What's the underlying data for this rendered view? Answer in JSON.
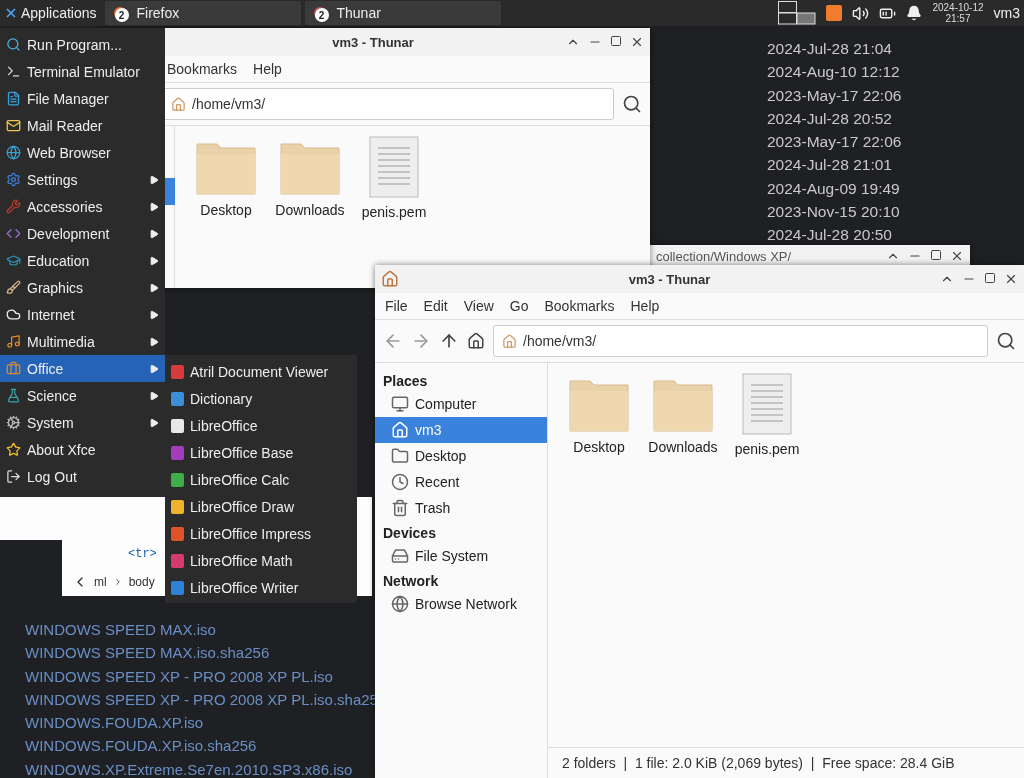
{
  "panel": {
    "apps_button": "Applications",
    "tasks": [
      {
        "label": "Firefox",
        "count": "2",
        "selected": false
      },
      {
        "label": "Thunar",
        "count": "2",
        "selected": false
      }
    ],
    "clock_date": "2024-10-12",
    "clock_time": "21:57",
    "user": "vm3"
  },
  "terminal": {
    "dates": [
      "2024-Jul-28 21:04",
      "2024-Aug-10 12:12",
      "2023-May-17 22:06",
      "2024-Jul-28 20:52",
      "2023-May-17 22:06",
      "2024-Jul-28 21:01",
      "2024-Aug-09 19:49",
      "2023-Nov-15 20:10",
      "2024-Jul-28 20:50"
    ],
    "files": [
      "WINDOWS SPEED MAX.iso",
      "WINDOWS SPEED MAX.iso.sha256",
      "WINDOWS SPEED XP - PRO 2008 XP PL.iso",
      "WINDOWS SPEED XP - PRO 2008 XP PL.iso.sha25",
      "WINDOWS.FOUDA.XP.iso",
      "WINDOWS.FOUDA.XP.iso.sha256",
      "WINDOWS.XP.Extreme.Se7en.2010.SP3.x86.iso"
    ]
  },
  "xp_window": {
    "title": "collection/Windows XP/"
  },
  "devtools": {
    "tag": "<tr>",
    "breadcrumbs": [
      "ml",
      "body"
    ]
  },
  "back_thunar": {
    "title": "vm3 - Thunar",
    "menu": [
      "Bookmarks",
      "Help"
    ],
    "address": "/home/vm3/",
    "files": [
      {
        "name": "Desktop",
        "kind": "folder"
      },
      {
        "name": "Downloads",
        "kind": "folder"
      },
      {
        "name": "penis.pem",
        "kind": "file"
      }
    ]
  },
  "front_thunar": {
    "title": "vm3 - Thunar",
    "menu": [
      "File",
      "Edit",
      "View",
      "Go",
      "Bookmarks",
      "Help"
    ],
    "address": "/home/vm3/",
    "sidebar": [
      {
        "heading": "Places",
        "items": [
          {
            "label": "Computer",
            "selected": false
          },
          {
            "label": "vm3",
            "selected": true
          },
          {
            "label": "Desktop",
            "selected": false
          },
          {
            "label": "Recent",
            "selected": false
          },
          {
            "label": "Trash",
            "selected": false
          }
        ]
      },
      {
        "heading": "Devices",
        "items": [
          {
            "label": "File System",
            "selected": false
          }
        ]
      },
      {
        "heading": "Network",
        "items": [
          {
            "label": "Browse Network",
            "selected": false
          }
        ]
      }
    ],
    "files": [
      {
        "name": "Desktop",
        "kind": "folder"
      },
      {
        "name": "Downloads",
        "kind": "folder"
      },
      {
        "name": "penis.pem",
        "kind": "file"
      }
    ],
    "status_bar": "2 folders  |  1 file: 2.0 KiB (2,069 bytes)  |  Free space: 28.4 GiB"
  },
  "app_menu": {
    "items": [
      {
        "label": "Run Program...",
        "submenu": false,
        "selected": false
      },
      {
        "label": "Terminal Emulator",
        "submenu": false,
        "selected": false
      },
      {
        "label": "File Manager",
        "submenu": false,
        "selected": false
      },
      {
        "label": "Mail Reader",
        "submenu": false,
        "selected": false
      },
      {
        "label": "Web Browser",
        "submenu": false,
        "selected": false
      },
      {
        "label": "Settings",
        "submenu": true,
        "selected": false
      },
      {
        "label": "Accessories",
        "submenu": true,
        "selected": false
      },
      {
        "label": "Development",
        "submenu": true,
        "selected": false
      },
      {
        "label": "Education",
        "submenu": true,
        "selected": false
      },
      {
        "label": "Graphics",
        "submenu": true,
        "selected": false
      },
      {
        "label": "Internet",
        "submenu": true,
        "selected": false
      },
      {
        "label": "Multimedia",
        "submenu": true,
        "selected": false
      },
      {
        "label": "Office",
        "submenu": true,
        "selected": true
      },
      {
        "label": "Science",
        "submenu": true,
        "selected": false
      },
      {
        "label": "System",
        "submenu": true,
        "selected": false
      },
      {
        "label": "About Xfce",
        "submenu": false,
        "selected": false
      },
      {
        "label": "Log Out",
        "submenu": false,
        "selected": false
      }
    ]
  },
  "office_submenu": {
    "items": [
      {
        "label": "Atril Document Viewer",
        "color": "#d83b3b"
      },
      {
        "label": "Dictionary",
        "color": "#3a8fd8"
      },
      {
        "label": "LibreOffice",
        "color": "#e8e8e8"
      },
      {
        "label": "LibreOffice Base",
        "color": "#a33dbd"
      },
      {
        "label": "LibreOffice Calc",
        "color": "#3dae49"
      },
      {
        "label": "LibreOffice Draw",
        "color": "#f0b42c"
      },
      {
        "label": "LibreOffice Impress",
        "color": "#e0532a"
      },
      {
        "label": "LibreOffice Math",
        "color": "#d63a6e"
      },
      {
        "label": "LibreOffice Writer",
        "color": "#2f83d6"
      }
    ]
  }
}
